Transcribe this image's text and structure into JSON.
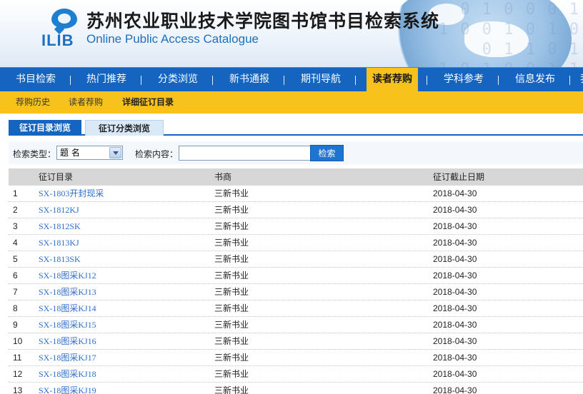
{
  "header": {
    "logo_text": "ILIB",
    "title": "苏州农业职业技术学院图书馆书目检索系统",
    "subtitle": "Online Public Access Catalogue",
    "binary_decoration": "0 1 0 0 0 1\n1 0 0 1 0 1 0\n0 1 1 0 1\n1 0 1 0 0 1 1"
  },
  "nav": {
    "items": [
      {
        "label": "书目检索"
      },
      {
        "label": "热门推荐"
      },
      {
        "label": "分类浏览"
      },
      {
        "label": "新书通报"
      },
      {
        "label": "期刊导航"
      },
      {
        "label": "读者荐购",
        "active": true
      },
      {
        "label": "学科参考"
      },
      {
        "label": "信息发布"
      },
      {
        "label": "我"
      }
    ]
  },
  "subnav": {
    "items": [
      {
        "label": "荐购历史"
      },
      {
        "label": "读者荐购"
      },
      {
        "label": "详细征订目录",
        "current": true
      }
    ]
  },
  "tabs": [
    {
      "label": "征订目录浏览",
      "active": true
    },
    {
      "label": "征订分类浏览",
      "active": false
    }
  ],
  "search": {
    "type_label": "检索类型：",
    "type_value": "题 名",
    "content_label": "检索内容：",
    "content_value": "",
    "button_label": "检索"
  },
  "table": {
    "columns": {
      "catalog": "征订目录",
      "vendor": "书商",
      "deadline": "征订截止日期"
    },
    "rows": [
      {
        "no": "1",
        "catalog": "SX-1803开封现采",
        "vendor": "三新书业",
        "deadline": "2018-04-30"
      },
      {
        "no": "2",
        "catalog": "SX-1812KJ",
        "vendor": "三新书业",
        "deadline": "2018-04-30"
      },
      {
        "no": "3",
        "catalog": "SX-1812SK",
        "vendor": "三新书业",
        "deadline": "2018-04-30"
      },
      {
        "no": "4",
        "catalog": "SX-1813KJ",
        "vendor": "三新书业",
        "deadline": "2018-04-30"
      },
      {
        "no": "5",
        "catalog": "SX-1813SK",
        "vendor": "三新书业",
        "deadline": "2018-04-30"
      },
      {
        "no": "6",
        "catalog": "SX-18图采KJ12",
        "vendor": "三新书业",
        "deadline": "2018-04-30"
      },
      {
        "no": "7",
        "catalog": "SX-18图采KJ13",
        "vendor": "三新书业",
        "deadline": "2018-04-30"
      },
      {
        "no": "8",
        "catalog": "SX-18图采KJ14",
        "vendor": "三新书业",
        "deadline": "2018-04-30"
      },
      {
        "no": "9",
        "catalog": "SX-18图采KJ15",
        "vendor": "三新书业",
        "deadline": "2018-04-30"
      },
      {
        "no": "10",
        "catalog": "SX-18图采KJ16",
        "vendor": "三新书业",
        "deadline": "2018-04-30"
      },
      {
        "no": "11",
        "catalog": "SX-18图采KJ17",
        "vendor": "三新书业",
        "deadline": "2018-04-30"
      },
      {
        "no": "12",
        "catalog": "SX-18图采KJ18",
        "vendor": "三新书业",
        "deadline": "2018-04-30"
      },
      {
        "no": "13",
        "catalog": "SX-18图采KJ19",
        "vendor": "三新书业",
        "deadline": "2018-04-30"
      }
    ]
  }
}
